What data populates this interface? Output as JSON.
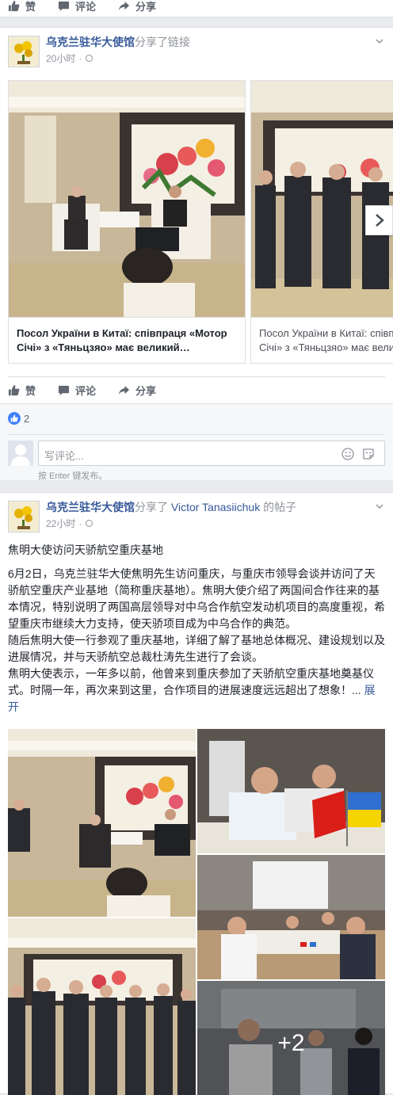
{
  "top_actions": {
    "like": "赞",
    "comment": "评论",
    "share": "分享"
  },
  "post1": {
    "page_name": "乌克兰驻华大使馆",
    "shared_verb": "分享了链接",
    "time": "20小时",
    "sep": "·",
    "carousel": [
      {
        "title": "Посол України в Китаї: співпраця «Мотор Січі» з «Тяньцзяо» має великий…"
      },
      {
        "title": "Посол України в Китаї: співпраця «Мотор Січі» з «Тяньцзяо» має великий…"
      }
    ],
    "actions": {
      "like": "赞",
      "comment": "评论",
      "share": "分享"
    },
    "like_count": "2",
    "comment_placeholder": "写评论...",
    "enter_hint": "按 Enter 键发布。"
  },
  "post2": {
    "page_name": "乌克兰驻华大使馆",
    "shared_verb": "分享了",
    "shared_user": "Victor Tanasiichuk",
    "shared_suffix": " 的帖子",
    "time": "22小时",
    "sep": "·",
    "text_title": "焦明大使访问天骄航空重庆基地",
    "para1": "6月2日，乌克兰驻华大使焦明先生访问重庆，与重庆市领导会谈并访问了天骄航空重庆产业基地（简称重庆基地）。焦明大使介绍了两国间合作往来的基本情况，特别说明了两国高层领导对中乌合作航空发动机项目的高度重视，希望重庆市继续大力支持，使天骄项目成为中乌合作的典范。",
    "para2": "随后焦明大使一行参观了重庆基地，详细了解了基地总体概况、建设规划以及进展情况，并与天骄航空总裁杜涛先生进行了会谈。",
    "para3": "焦明大使表示，一年多以前，他曾来到重庆参加了天骄航空重庆基地奠基仪式。时隔一年，再次来到这里，合作项目的进展速度远远超出了想象！",
    "ellipsis": "...",
    "see_more": "展开",
    "more_photos": "+2"
  },
  "colors": {
    "link": "#365899",
    "grey": "#90949c",
    "bg": "#e9ebee"
  }
}
